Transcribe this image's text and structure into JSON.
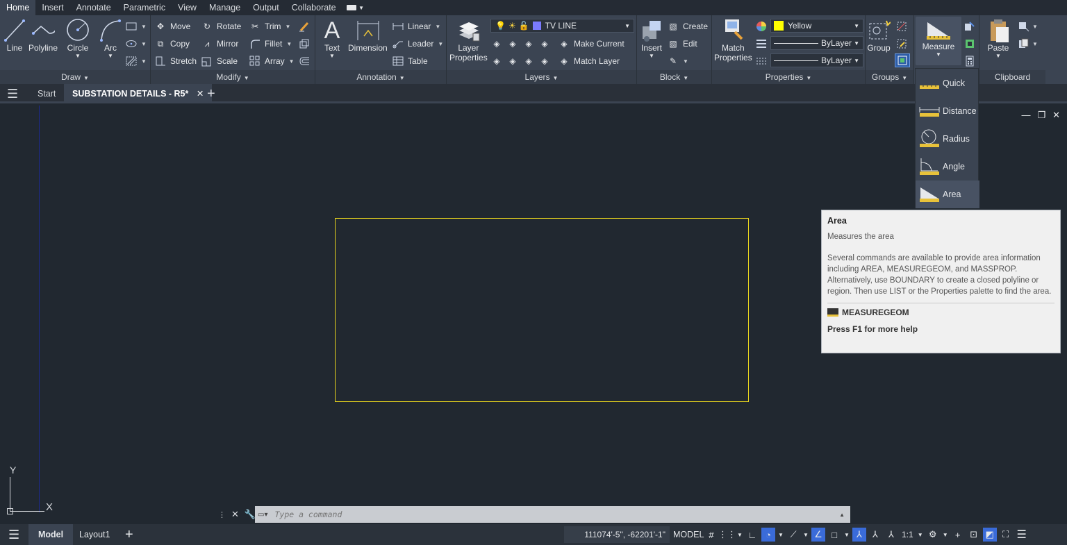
{
  "menu_tabs": [
    "Home",
    "Insert",
    "Annotate",
    "Parametric",
    "View",
    "Manage",
    "Output",
    "Collaborate"
  ],
  "ribbon": {
    "draw": {
      "title": "Draw",
      "line": "Line",
      "polyline": "Polyline",
      "circle": "Circle",
      "arc": "Arc"
    },
    "modify": {
      "title": "Modify",
      "move": "Move",
      "rotate": "Rotate",
      "trim": "Trim",
      "copy": "Copy",
      "mirror": "Mirror",
      "fillet": "Fillet",
      "stretch": "Stretch",
      "scale": "Scale",
      "array": "Array"
    },
    "annotation": {
      "title": "Annotation",
      "text": "Text",
      "dimension": "Dimension",
      "linear": "Linear",
      "leader": "Leader",
      "table": "Table"
    },
    "layers": {
      "title": "Layers",
      "layer_properties_1": "Layer",
      "layer_properties_2": "Properties",
      "current_layer": "TV LINE",
      "make_current": "Make Current",
      "match_layer": "Match Layer",
      "layer_color": "#7b7bff"
    },
    "block": {
      "title": "Block",
      "insert": "Insert",
      "create": "Create",
      "edit": "Edit"
    },
    "properties": {
      "title": "Properties",
      "match_1": "Match",
      "match_2": "Properties",
      "color": "Yellow",
      "color_swatch": "#ffff00",
      "linetype": "ByLayer",
      "lineweight": "ByLayer"
    },
    "groups": {
      "title": "Groups",
      "group": "Group"
    },
    "utilities": {
      "measure": "Measure"
    },
    "clipboard": {
      "title": "Clipboard",
      "paste": "Paste"
    }
  },
  "doc_tabs": {
    "start": "Start",
    "current": "SUBSTATION DETAILS - R5*"
  },
  "measure_menu": [
    "Quick",
    "Distance",
    "Radius",
    "Angle",
    "Area"
  ],
  "tooltip": {
    "title": "Area",
    "desc": "Measures the area",
    "body": "Several commands are available to provide area information including AREA, MEASUREGEOM, and MASSPROP. Alternatively, use BOUNDARY to create a closed polyline or region. Then use LIST or the Properties palette to find the area.",
    "command": "MEASUREGEOM",
    "help": "Press F1 for more help"
  },
  "ucs": {
    "x": "X",
    "y": "Y"
  },
  "command_line": {
    "placeholder": "Type a command"
  },
  "status": {
    "model_tab": "Model",
    "layout_tab": "Layout1",
    "coords": "111074'-5\", -62201'-1\"",
    "mode": "MODEL",
    "scale": "1:1"
  }
}
